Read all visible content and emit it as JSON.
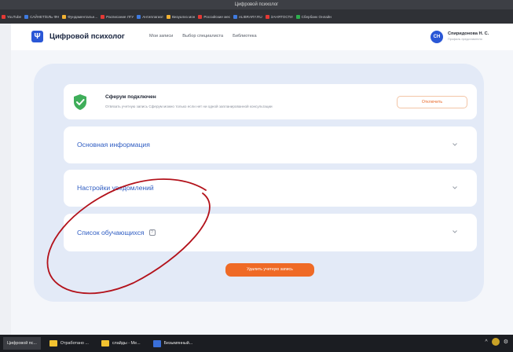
{
  "browser": {
    "window_title": "Цифровой психолог",
    "bookmarks": [
      {
        "label": "YouTube",
        "color": "#e53935"
      },
      {
        "label": "САЙНЕТ/ЕЛЬ ФН",
        "color": "#3f7be0"
      },
      {
        "label": "Фундаментальн...",
        "color": "#f2b233"
      },
      {
        "label": "Расписание ЛГУ",
        "color": "#e53935"
      },
      {
        "label": "Антиплагиат",
        "color": "#3f7be0"
      },
      {
        "label": "Визуализ мон",
        "color": "#f2b233"
      },
      {
        "label": "Российские мес",
        "color": "#e53935"
      },
      {
        "label": "eLIBRARY.RU",
        "color": "#3f7be0"
      },
      {
        "label": "ЗАНЯТОСТИ",
        "color": "#e53935"
      },
      {
        "label": "Сбербанк Онлайн",
        "color": "#2eae4e"
      }
    ]
  },
  "header": {
    "brand": "Цифровой психолог",
    "nav": [
      "Мои записи",
      "Выбор специалиста",
      "Библиотека"
    ],
    "avatar_initials": "СН",
    "user_name": "Спиридонова Н. С.",
    "user_sub": "Профиль представителя"
  },
  "sferum": {
    "title": "Сферум подключен",
    "description": "Отвязать учетную запись Сферум можно только если нет ни одной запланированной консультации",
    "disconnect_label": "Отключить"
  },
  "sections": [
    {
      "title": "Основная информация"
    },
    {
      "title": "Настройки уведомлений"
    },
    {
      "title": "Список обучающихся"
    }
  ],
  "delete_button": "Удалить учетную запись",
  "colors": {
    "accent_blue": "#2a57d6",
    "accent_orange": "#ef6a26",
    "annotation_red": "#b3121b",
    "success_green": "#3fae5a"
  },
  "taskbar": {
    "items": [
      {
        "label": "Цифровой пс...",
        "icon": "browser-icon"
      },
      {
        "label": "Отработано ...",
        "icon": "folder-icon"
      },
      {
        "label": "слайды - Ме...",
        "icon": "folder-icon"
      },
      {
        "label": "Безымянный...",
        "icon": "paint-icon"
      }
    ]
  }
}
